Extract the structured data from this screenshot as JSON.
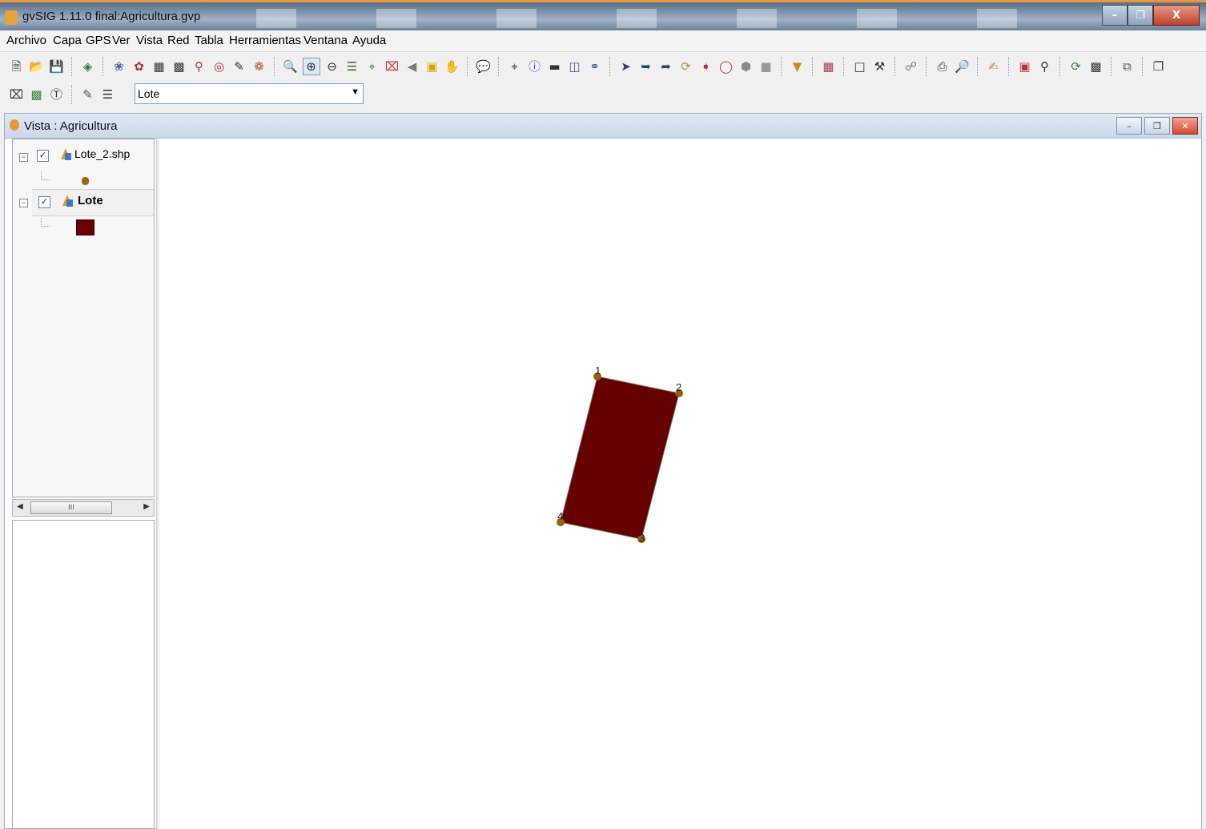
{
  "window": {
    "title": "gvSIG 1.11.0 final:Agricultura.gvp",
    "buttons": [
      "minimize",
      "restore",
      "close"
    ]
  },
  "menu": {
    "items": [
      "Archivo",
      "Capa",
      "GPS",
      "Ver",
      "Vista",
      "Red",
      "Tabla",
      "Herramientas",
      "Ventana",
      "Ayuda"
    ]
  },
  "toolbar": {
    "layer_combo_value": "Lote"
  },
  "view": {
    "title": "Vista : Agricultura"
  },
  "toc": {
    "layers": [
      {
        "name": "Lote_2.shp",
        "checked": true,
        "expanded": true,
        "symbol": "point",
        "symbol_color": "#a5660c",
        "bold": false
      },
      {
        "name": "Lote",
        "checked": true,
        "expanded": true,
        "symbol": "fill",
        "symbol_color": "#6b0000",
        "bold": true,
        "selected": true
      }
    ],
    "scrollbar_thumb": "III"
  },
  "map": {
    "polygon_fill": "#650000",
    "vertex_color": "#9a5e10",
    "vertex_labels": [
      "1",
      "2",
      "3",
      "4"
    ]
  }
}
